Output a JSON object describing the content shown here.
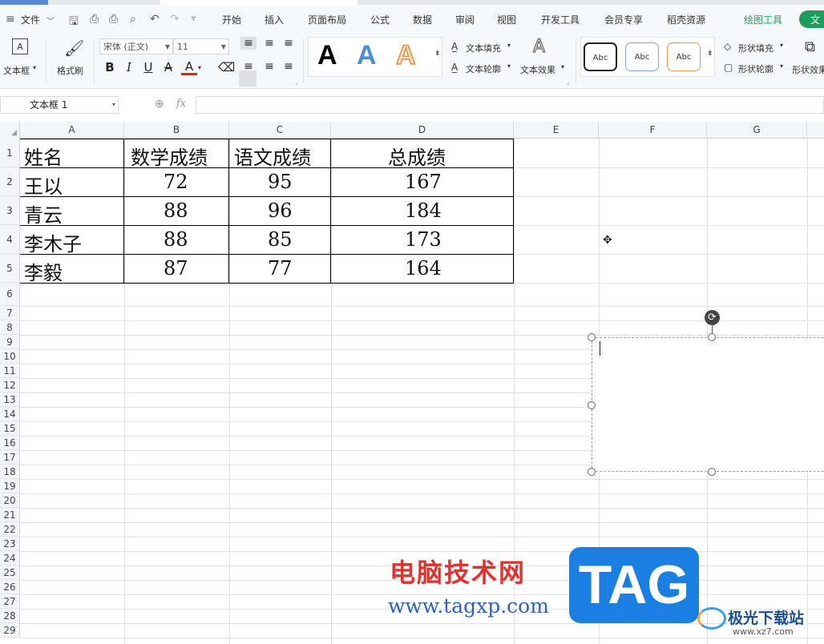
{
  "colors": {
    "green_accent": "#1e9e5a",
    "watermark_red": "#e5302d",
    "watermark_blue": "#2f62c5",
    "tag_blue": "#1a7fe0"
  },
  "menubar": {
    "file_label": "文件",
    "tabs": [
      "开始",
      "插入",
      "页面布局",
      "公式",
      "数据",
      "审阅",
      "视图",
      "开发工具",
      "会员专享",
      "稻壳资源",
      "绘图工具",
      "文"
    ]
  },
  "ribbon": {
    "textbox_label": "文本框",
    "format_painter_label": "格式刷",
    "font_name": "宋体 (正文)",
    "font_size": "11",
    "big_A": "A",
    "text_fill": "文本填充",
    "text_outline": "文本轮廓",
    "text_effect": "文本效果",
    "style_sample": "Abc",
    "shape_fill": "形状填充",
    "shape_outline": "形状轮廓",
    "shape_effect": "形状效果"
  },
  "formula_bar": {
    "name_box": "文本框 1",
    "fx": "fx"
  },
  "columns": [
    "A",
    "B",
    "C",
    "D",
    "E",
    "F",
    "G"
  ],
  "rows": [
    "1",
    "2",
    "3",
    "4",
    "5",
    "6",
    "7",
    "8",
    "9",
    "10",
    "11",
    "12",
    "13",
    "14",
    "15",
    "16",
    "17",
    "18",
    "19",
    "20",
    "21",
    "22",
    "23",
    "24",
    "25",
    "26",
    "27",
    "28",
    "29"
  ],
  "table": {
    "headers": [
      "姓名",
      "数学成绩",
      "语文成绩",
      "总成绩"
    ],
    "rows": [
      [
        "王以",
        "72",
        "95",
        "167"
      ],
      [
        "青云",
        "88",
        "96",
        "184"
      ],
      [
        "李木子",
        "88",
        "85",
        "173"
      ],
      [
        "李毅",
        "87",
        "77",
        "164"
      ]
    ]
  },
  "watermark": {
    "cn": "电脑技术网",
    "url": "www.tagxp.com",
    "tag": "TAG",
    "site": "极光下载站",
    "site_url": "www.xz7.com"
  }
}
